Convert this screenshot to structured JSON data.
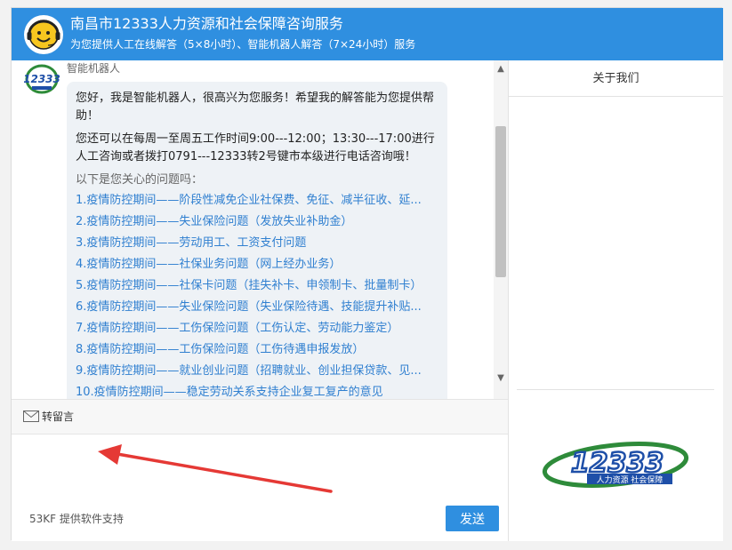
{
  "header": {
    "title": "南昌市12333人力资源和社会保障咨询服务",
    "subtitle": "为您提供人工在线解答（5×8小时）、智能机器人解答（7×24小时）服务"
  },
  "chat": {
    "bot_name": "智能机器人",
    "greeting": "您好，我是智能机器人，很高兴为您服务！希望我的解答能为您提供帮助！",
    "contact": "您还可以在每周一至周五工作时间9:00---12:00；13:30---17:00进行人工咨询或者拨打0791---12333转2号键市本级进行电话咨询哦！",
    "questions_heading": "以下是您关心的问题吗：",
    "questions": [
      "1.疫情防控期间——阶段性减免企业社保费、免征、减半征收、延...",
      "2.疫情防控期间——失业保险问题（发放失业补助金）",
      "3.疫情防控期间——劳动用工、工资支付问题",
      "4.疫情防控期间——社保业务问题（网上经办业务）",
      "5.疫情防控期间——社保卡问题（挂失补卡、申领制卡、批量制卡）",
      "6.疫情防控期间——失业保险问题（失业保险待遇、技能提升补贴...",
      "7.疫情防控期间——工伤保险问题（工伤认定、劳动能力鉴定）",
      "8.疫情防控期间——工伤保险问题（工伤待遇申报发放）",
      "9.疫情防控期间——就业创业问题（招聘就业、创业担保贷款、见...",
      "10.疫情防控期间——稳定劳动关系支持企业复工复产的意见"
    ]
  },
  "toolbar": {
    "leave_message": "转留言"
  },
  "composer": {
    "value": "",
    "footer": "53KF 提供软件支持",
    "send_label": "发送"
  },
  "side": {
    "tab": "关于我们",
    "logo_number": "12333",
    "logo_text": "人力资源  社会保障"
  },
  "colors": {
    "header_bg": "#2f8fe0",
    "link": "#2f7fd0",
    "bubble_bg": "#eef2f6",
    "arrow": "#e53935",
    "logo_blue": "#1e4fa8",
    "logo_green": "#2e8b3a"
  },
  "icons": {
    "scroll_up": "▲",
    "scroll_down": "▼"
  }
}
